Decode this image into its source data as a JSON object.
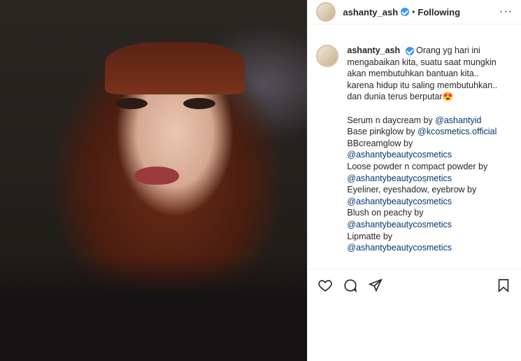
{
  "post": {
    "username": "ashanty_ash",
    "dot": "•",
    "follow_status": "Following",
    "more": "···"
  },
  "caption": {
    "username": "ashanty_ash",
    "text": "Orang yg hari ini mengabaikan kita, suatu saat mungkin akan membutuhkan bantuan kita.. karena hidup itu saling membutuhkan.. dan dunia terus berputar😍",
    "lines": [
      {
        "text": "Serum n daycream by ",
        "mention": "@ashantyid"
      },
      {
        "text": "Base pinkglow by ",
        "mention": "@kcosmetics.official"
      },
      {
        "text": "BBcreamglow by",
        "mention": ""
      },
      {
        "text": "",
        "mention": "@ashantybeautycosmetics"
      },
      {
        "text": "Loose powder n compact powder by",
        "mention": ""
      },
      {
        "text": "",
        "mention": "@ashantybeautycosmetics"
      },
      {
        "text": "Eyeliner, eyeshadow, eyebrow by",
        "mention": ""
      },
      {
        "text": "",
        "mention": "@ashantybeautycosmetics"
      },
      {
        "text": "Blush on peachy by",
        "mention": ""
      },
      {
        "text": "",
        "mention": "@ashantybeautycosmetics"
      },
      {
        "text": "Lipmatte by",
        "mention": ""
      },
      {
        "text": "",
        "mention": "@ashantybeautycosmetics"
      }
    ]
  },
  "actions": {
    "like_icon": "heart-icon",
    "comment_icon": "comment-icon",
    "share_icon": "share-icon",
    "save_icon": "bookmark-icon"
  }
}
